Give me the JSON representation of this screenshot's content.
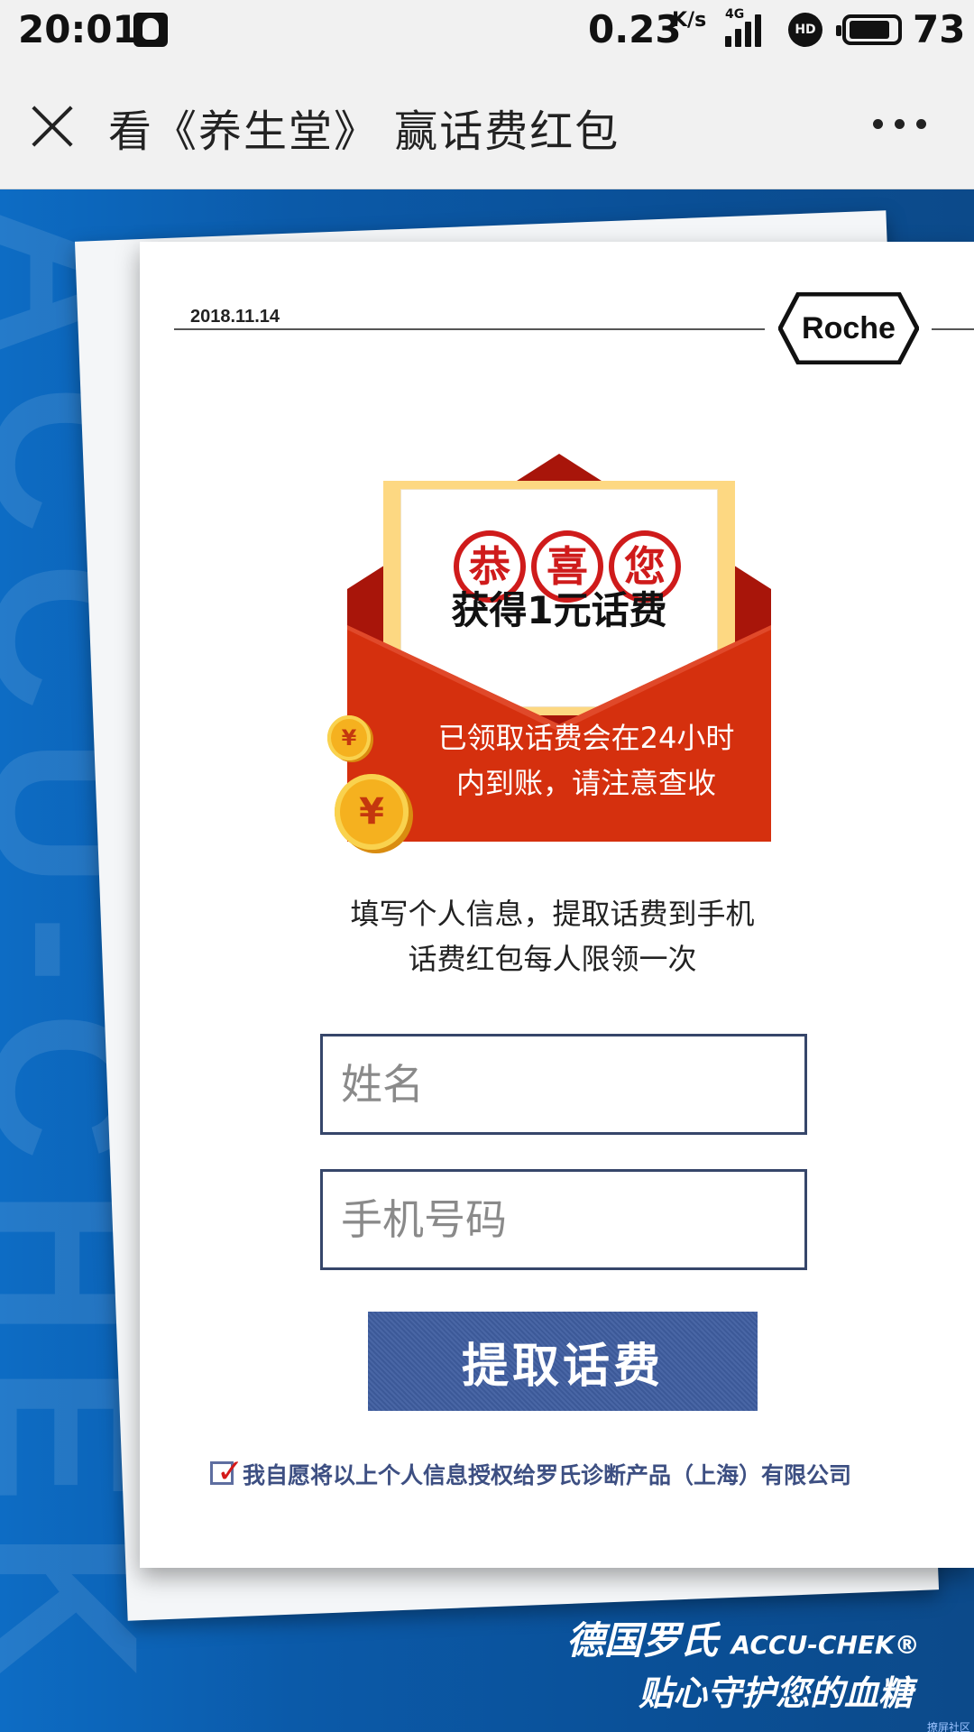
{
  "status_bar": {
    "time": "20:01",
    "speed": "0.23",
    "speed_unit": "K/s",
    "network": "4G",
    "hd": "HD",
    "battery": "73"
  },
  "title_bar": {
    "title": "看《养生堂》 赢话费红包"
  },
  "card": {
    "date": "2018.11.14",
    "logo": "Roche",
    "congrats_chars": [
      "恭",
      "喜",
      "您"
    ],
    "prize": "获得1元话费",
    "notice_line1": "已领取话费会在24小时",
    "notice_line2": "内到账，请注意查收",
    "coin_symbol": "¥",
    "info_line1": "填写个人信息，提取话费到手机",
    "info_line2": "话费红包每人限领一次",
    "name_placeholder": "姓名",
    "phone_placeholder": "手机号码",
    "submit_label": "提取话费",
    "consent_text": "我自愿将以上个人信息授权给罗氏诊断产品（上海）有限公司",
    "consent_checked": true
  },
  "background": {
    "watermark": "ACCU-CHEK"
  },
  "brand": {
    "line1_cn": "德国罗氏",
    "line1_en": "ACCU-CHEK®",
    "line2": "贴心守护您的血糖"
  },
  "corner_text": "撩屏社区",
  "colors": {
    "accent_blue": "#3f5ea0",
    "envelope_red": "#d5300e",
    "congrats_red": "#cf1b1b",
    "background_blue": "#0b5aa9"
  }
}
